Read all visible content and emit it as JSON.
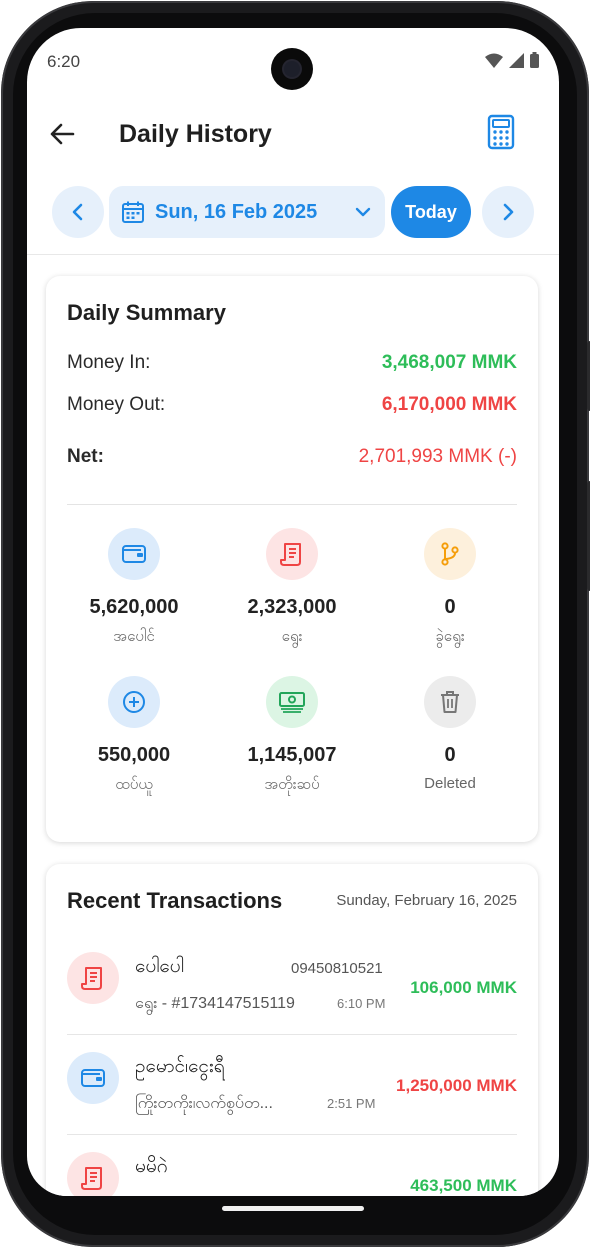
{
  "status_bar": {
    "time": "6:20"
  },
  "app_bar": {
    "title": "Daily History"
  },
  "date_nav": {
    "date": "Sun, 16 Feb 2025",
    "today_label": "Today"
  },
  "summary": {
    "title": "Daily Summary",
    "money_in_label": "Money In:",
    "money_in_value": "3,468,007 MMK",
    "money_out_label": "Money Out:",
    "money_out_value": "6,170,000 MMK",
    "net_label": "Net:",
    "net_value": "2,701,993 MMK (-)",
    "stats": [
      {
        "value": "5,620,000",
        "label": "အပေါင်",
        "icon": "wallet-icon",
        "color": "#1e88e5",
        "bg": "#dcebfb"
      },
      {
        "value": "2,323,000",
        "label": "ရွေး",
        "icon": "receipt-icon",
        "color": "#ef4444",
        "bg": "#fde4e4"
      },
      {
        "value": "0",
        "label": "ခွဲရွေး",
        "icon": "split-icon",
        "color": "#f59e0b",
        "bg": "#fdf0dc"
      },
      {
        "value": "550,000",
        "label": "ထပ်ယူ",
        "icon": "plus-circle-icon",
        "color": "#1e88e5",
        "bg": "#dcebfb"
      },
      {
        "value": "1,145,007",
        "label": "အတိုးဆပ်",
        "icon": "cash-icon",
        "color": "#22a55a",
        "bg": "#dcf5e4"
      },
      {
        "value": "0",
        "label": "Deleted",
        "icon": "trash-icon",
        "color": "#777777",
        "bg": "#ececec"
      }
    ]
  },
  "recent": {
    "title": "Recent Transactions",
    "date": "Sunday, February 16, 2025",
    "items": [
      {
        "name": "ပေါပေါ",
        "phone": "09450810521",
        "sub": "ရွေး - #1734147515119",
        "time": "6:10 PM",
        "amount": "106,000 MMK",
        "type": "in",
        "icon": "receipt-icon"
      },
      {
        "name": "ဥမောင်၊ငွေးရီ",
        "phone": "",
        "sub": "ကြိုးတကိုး၊လက်စွပ်တ...",
        "time": "2:51 PM",
        "amount": "1,250,000 MMK",
        "type": "out",
        "icon": "wallet-icon"
      },
      {
        "name": "မမိဂဲ",
        "phone": "",
        "sub": "",
        "time": "",
        "amount": "463,500 MMK",
        "type": "in",
        "icon": "receipt-icon"
      }
    ]
  },
  "colors": {
    "accent": "#1e88e5",
    "positive": "#2ebd59",
    "negative": "#ef4444"
  }
}
